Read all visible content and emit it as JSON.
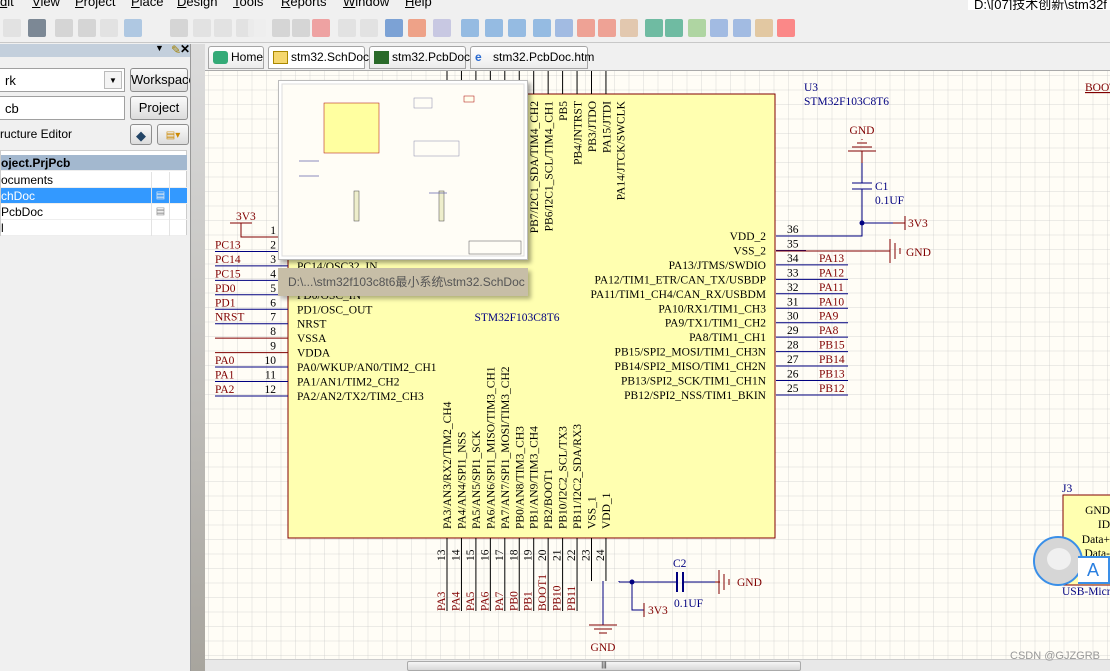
{
  "menu": [
    "dit",
    "View",
    "Project",
    "Place",
    "Design",
    "Tools",
    "Reports",
    "Window",
    "Help"
  ],
  "path_box": "D:\\[07]技术创新\\stm32f",
  "panel": {
    "workspace_value": "rk",
    "workspace_button": "Workspace",
    "project_value": "cb",
    "project_button": "Project",
    "structure_editor": "ructure Editor",
    "tree_header": "oject.PrjPcb",
    "tree_rows": [
      "ocuments",
      "chDoc",
      "PcbDoc",
      "l"
    ]
  },
  "tabs": [
    "Home",
    "stm32.SchDoc",
    "stm32.PcbDoc",
    "stm32.PcbDoc.htm"
  ],
  "tooltip": "D:\\...\\stm32f103c8t6最小系统\\stm32.SchDoc",
  "schematic": {
    "designator": "U3",
    "part": "STM32F103C8T6",
    "center_label": "STM32F103C8T6",
    "left_pins": [
      {
        "n": "1",
        "name": "",
        "net": "3V3"
      },
      {
        "n": "2",
        "name": "",
        "net": "PC13"
      },
      {
        "n": "3",
        "name": "PC14/OSC32_IN",
        "net": "PC14"
      },
      {
        "n": "4",
        "name": "",
        "net": "PC15"
      },
      {
        "n": "5",
        "name": "PD0/OSC_IN",
        "net": "PD0"
      },
      {
        "n": "6",
        "name": "PD1/OSC_OUT",
        "net": "PD1"
      },
      {
        "n": "7",
        "name": "NRST",
        "net": "NRST"
      },
      {
        "n": "8",
        "name": "VSSA",
        "net": ""
      },
      {
        "n": "9",
        "name": "VDDA",
        "net": ""
      },
      {
        "n": "10",
        "name": "PA0/WKUP/AN0/TIM2_CH1",
        "net": "PA0"
      },
      {
        "n": "11",
        "name": "PA1/AN1/TIM2_CH2",
        "net": "PA1"
      },
      {
        "n": "12",
        "name": "PA2/AN2/TX2/TIM2_CH3",
        "net": "PA2"
      }
    ],
    "right_pins": [
      {
        "n": "36",
        "name": "VDD_2",
        "net": ""
      },
      {
        "n": "35",
        "name": "VSS_2",
        "net": ""
      },
      {
        "n": "34",
        "name": "PA13/JTMS/SWDIO",
        "net": "PA13"
      },
      {
        "n": "33",
        "name": "PA12/TIM1_ETR/CAN_TX/USBDP",
        "net": "PA12"
      },
      {
        "n": "32",
        "name": "PA11/TIM1_CH4/CAN_RX/USBDM",
        "net": "PA11"
      },
      {
        "n": "31",
        "name": "PA10/RX1/TIM1_CH3",
        "net": "PA10"
      },
      {
        "n": "30",
        "name": "PA9/TX1/TIM1_CH2",
        "net": "PA9"
      },
      {
        "n": "29",
        "name": "PA8/TIM1_CH1",
        "net": "PA8"
      },
      {
        "n": "28",
        "name": "PB15/SPI2_MOSI/TIM1_CH3N",
        "net": "PB15"
      },
      {
        "n": "27",
        "name": "PB14/SPI2_MISO/TIM1_CH2N",
        "net": "PB14"
      },
      {
        "n": "26",
        "name": "PB13/SPI2_SCK/TIM1_CH1N",
        "net": "PB13"
      },
      {
        "n": "25",
        "name": "PB12/SPI2_NSS/TIM1_BKIN",
        "net": "PB12"
      }
    ],
    "bottom_pins": [
      {
        "n": "13",
        "name": "PA3/AN3/RX2/TIM2_CH4",
        "net": "PA3"
      },
      {
        "n": "14",
        "name": "PA4/AN4/SPI1_NSS",
        "net": "PA4"
      },
      {
        "n": "15",
        "name": "PA5/AN5/SPI1_SCK",
        "net": "PA5"
      },
      {
        "n": "16",
        "name": "PA6/AN6/SPI1_MISO/TIM3_CH1",
        "net": "PA6"
      },
      {
        "n": "17",
        "name": "PA7/AN7/SPI1_MOSI/TIM3_CH2",
        "net": "PA7"
      },
      {
        "n": "18",
        "name": "PB0/AN8/TIM3_CH3",
        "net": "PB0"
      },
      {
        "n": "19",
        "name": "PB1/AN9/TIM3_CH4",
        "net": "PB1"
      },
      {
        "n": "20",
        "name": "PB2/BOOT1",
        "net": "BOOT1"
      },
      {
        "n": "21",
        "name": "PB10/I2C2_SCL/TX3",
        "net": "PB10"
      },
      {
        "n": "22",
        "name": "PB11/I2C2_SDA/RX3",
        "net": "PB11"
      },
      {
        "n": "23",
        "name": "VSS_1",
        "net": ""
      },
      {
        "n": "24",
        "name": "VDD_1",
        "net": ""
      }
    ],
    "top_pins_visible": [
      "PB7/I2C1_SDA/TIM4_CH2",
      "PB6/I2C1_SCL/TIM4_CH1",
      "PB5",
      "PB4/JNTRST",
      "PB3/JTDO",
      "PA15/JTDI",
      "PA14/JTCK/SWCLK"
    ],
    "c1": {
      "ref": "C1",
      "value": "0.1UF"
    },
    "c2": {
      "ref": "C2",
      "value": "0.1UF"
    },
    "gnd": "GND",
    "vcc": "3V3",
    "boot_label": "BOOT",
    "j3": {
      "ref": "J3",
      "pins": [
        "GND",
        "ID",
        "Data+",
        "Data-"
      ],
      "part": "USB-Micro"
    }
  },
  "avatar_badge": "A",
  "watermark": "CSDN @GJZGRB"
}
